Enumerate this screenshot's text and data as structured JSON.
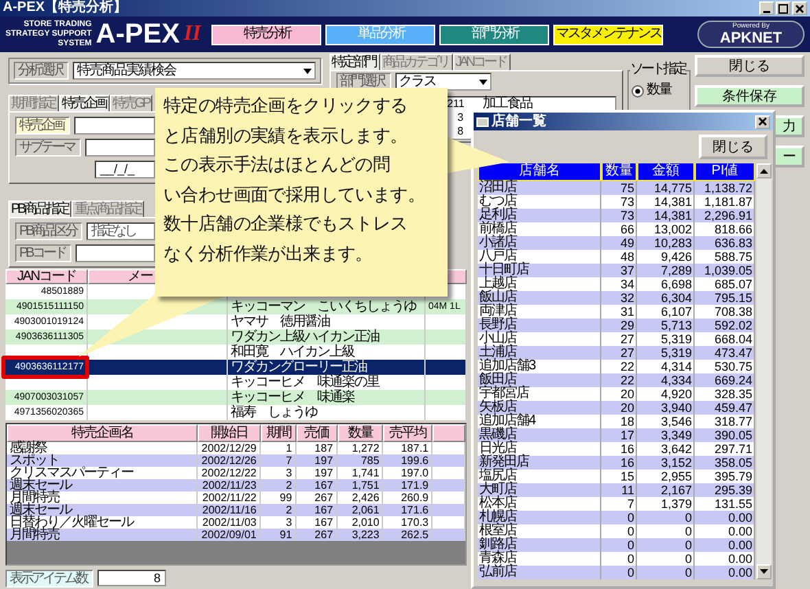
{
  "window": {
    "title": "A-PEX【特売分析】"
  },
  "header": {
    "logo_lines": [
      "STORE TRADING",
      "STRATEGY SUPPORT",
      "SYSTEM"
    ],
    "logo": "A-PEX",
    "logo_suffix": "II",
    "brand_small": "Powered By",
    "brand": "APKNET",
    "nav": [
      {
        "label": "特売分析",
        "color": "#f8b8d4"
      },
      {
        "label": "単品分析",
        "color": "#58b0f8"
      },
      {
        "label": "部門分析",
        "color": "#208880"
      },
      {
        "label": "マスタメンテナンス",
        "color": "#f8f000"
      }
    ]
  },
  "analysis": {
    "label": "分析選択",
    "value": "特売商品実績検会"
  },
  "period_tabs": [
    {
      "label": "期間指定",
      "selected": false
    },
    {
      "label": "特売企画",
      "selected": true
    },
    {
      "label": "特売GP",
      "selected": false
    }
  ],
  "sale_fields": [
    {
      "label": "特売企画"
    },
    {
      "label": "サブテーマ"
    }
  ],
  "date_field": {
    "value": "__/_/_"
  },
  "pb_tabs": [
    {
      "label": "PB商品指定",
      "selected": true
    },
    {
      "label": "重点商品指定",
      "selected": false
    }
  ],
  "pb_fields": [
    {
      "label": "PB商品区分",
      "value": "指定なし"
    },
    {
      "label": "PBコード"
    }
  ],
  "dept_tabs": [
    {
      "label": "特定部門",
      "selected": true
    },
    {
      "label": "商品カテゴリ",
      "selected": false
    },
    {
      "label": "JANコード",
      "selected": false
    }
  ],
  "dept": {
    "label": "部門選択",
    "value": "クラス",
    "rows": [
      {
        "code": "211",
        "name": "加工食品"
      },
      {
        "code": "3"
      },
      {
        "code": "8"
      }
    ]
  },
  "sort": {
    "title": "ソート指定",
    "options": [
      {
        "label": "数量",
        "selected": true
      }
    ]
  },
  "buttons": [
    {
      "label": "閉じる",
      "kind": "plain"
    },
    {
      "label": "条件保存",
      "kind": "green"
    },
    {
      "label": "力",
      "kind": "cut"
    },
    {
      "label": "ー",
      "kind": "cut"
    }
  ],
  "jan_table": {
    "columns": [
      {
        "label": "JANコード"
      },
      {
        "label": "メー"
      },
      {},
      {}
    ],
    "rows": [
      {
        "code": "48501889",
        "selected": false
      },
      {
        "code": "4901515111150",
        "name": "キッコーマン　こいくちしょうゆ",
        "spec": "04M 1L",
        "selected": false
      },
      {
        "code": "4903001019124",
        "name": "ヤマサ　徳用醤油",
        "selected": false
      },
      {
        "code": "4903636111305",
        "name": "ワダカン上級ハイカン正油",
        "selected": false
      },
      {
        "name": "和田寛　ハイカン上級",
        "selected": false
      },
      {
        "code": "4903636112177",
        "name": "ワダカングローリー正油",
        "selected": true
      },
      {
        "name": "キッコーヒメ　味通楽の里",
        "selected": false
      },
      {
        "code": "4907003031057",
        "name": "キッコーヒメ　味通楽",
        "selected": false
      },
      {
        "code": "4971356020365",
        "name": "福寿　しょうゆ",
        "selected": false
      }
    ]
  },
  "sales_table": {
    "columns": [
      "特売企画名",
      "開始日",
      "期間",
      "売価",
      "数量",
      "売平均"
    ],
    "rows": [
      [
        "感謝祭",
        "2002/12/29",
        "1",
        "187",
        "1,272",
        "187.1"
      ],
      [
        "スポット",
        "2002/12/26",
        "7",
        "197",
        "785",
        "199.6"
      ],
      [
        "クリスマスパーティー",
        "2002/12/22",
        "3",
        "197",
        "1,741",
        "197.0"
      ],
      [
        "週末セール",
        "2002/11/23",
        "2",
        "167",
        "1,751",
        "171.9"
      ],
      [
        "月間特売",
        "2002/11/22",
        "99",
        "267",
        "2,426",
        "260.9"
      ],
      [
        "週末セール",
        "2002/11/16",
        "2",
        "167",
        "2,061",
        "171.6"
      ],
      [
        "日替わり／火曜セール",
        "2002/11/03",
        "3",
        "167",
        "2,010",
        "170.3"
      ],
      [
        "月間特売",
        "2002/09/01",
        "91",
        "267",
        "3,223",
        "262.5"
      ]
    ]
  },
  "status": {
    "label": "表示アイテム数",
    "value": "8"
  },
  "callout": {
    "lines": [
      "特定の特売企画をクリックする",
      "と店舗別の実績を表示します。",
      "この表示手法はほとんどの問",
      "い合わせ画面で採用しています。",
      "数十店舗の企業様でもストレス",
      "なく分析作業が出来ます。"
    ]
  },
  "popup": {
    "title": "店舗一覧",
    "close": "閉じる",
    "columns": [
      "店舗名",
      "数量",
      "金額",
      "PI値"
    ],
    "rows": [
      [
        "沼田店",
        "75",
        "14,775",
        "1,138.72"
      ],
      [
        "むつ店",
        "73",
        "14,381",
        "1,181.87"
      ],
      [
        "足利店",
        "73",
        "14,381",
        "2,296.91"
      ],
      [
        "前橋店",
        "66",
        "13,002",
        "818.66"
      ],
      [
        "小諸店",
        "49",
        "10,283",
        "636.83"
      ],
      [
        "八戸店",
        "48",
        "9,426",
        "588.75"
      ],
      [
        "十日町店",
        "37",
        "7,289",
        "1,039.05"
      ],
      [
        "上越店",
        "34",
        "6,698",
        "685.07"
      ],
      [
        "飯山店",
        "32",
        "6,304",
        "795.15"
      ],
      [
        "両津店",
        "31",
        "6,107",
        "708.38"
      ],
      [
        "長野店",
        "29",
        "5,713",
        "592.02"
      ],
      [
        "小山店",
        "27",
        "5,319",
        "668.04"
      ],
      [
        "土浦店",
        "27",
        "5,319",
        "473.47"
      ],
      [
        "追加店舗3",
        "22",
        "4,314",
        "530.75"
      ],
      [
        "飯田店",
        "22",
        "4,334",
        "669.24"
      ],
      [
        "宇都宮店",
        "20",
        "4,920",
        "328.35"
      ],
      [
        "矢板店",
        "20",
        "3,940",
        "459.47"
      ],
      [
        "追加店舗4",
        "18",
        "3,546",
        "318.77"
      ],
      [
        "黒磯店",
        "17",
        "3,349",
        "390.05"
      ],
      [
        "日光店",
        "16",
        "3,642",
        "297.71"
      ],
      [
        "新発田店",
        "16",
        "3,152",
        "358.05"
      ],
      [
        "塩尻店",
        "15",
        "2,955",
        "395.79"
      ],
      [
        "大町店",
        "11",
        "2,167",
        "295.39"
      ],
      [
        "松本店",
        "7",
        "1,379",
        "131.55"
      ],
      [
        "札幌店",
        "0",
        "0",
        "0.00"
      ],
      [
        "根室店",
        "0",
        "0",
        "0.00"
      ],
      [
        "釧路店",
        "0",
        "0",
        "0.00"
      ],
      [
        "青森店",
        "0",
        "0",
        "0.00"
      ],
      [
        "弘前店",
        "0",
        "0",
        "0.00"
      ]
    ]
  }
}
